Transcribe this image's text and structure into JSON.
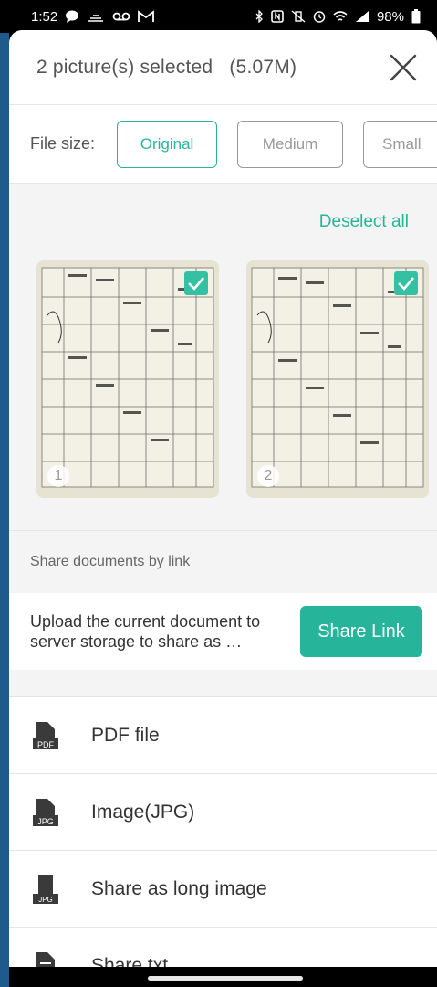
{
  "status_bar": {
    "time": "1:52",
    "battery": "98%"
  },
  "header": {
    "title": "2 picture(s) selected   (5.07M)"
  },
  "file_size": {
    "label": "File size:",
    "options": [
      "Original",
      "Medium",
      "Small"
    ],
    "selected": "Original"
  },
  "gallery": {
    "deselect_label": "Deselect all",
    "items": [
      {
        "number": "1",
        "selected": true
      },
      {
        "number": "2",
        "selected": true
      }
    ]
  },
  "share_link": {
    "heading": "Share documents by link",
    "description": "Upload the current document to server storage to share as …",
    "button_label": "Share Link"
  },
  "share_options": [
    {
      "icon": "pdf-file-icon",
      "icon_tag": "PDF",
      "label": "PDF file"
    },
    {
      "icon": "jpg-file-icon",
      "icon_tag": "JPG",
      "label": "Image(JPG)"
    },
    {
      "icon": "long-image-icon",
      "icon_tag": "JPG",
      "label": "Share as long image"
    },
    {
      "icon": "txt-file-icon",
      "icon_tag": "",
      "label": "Share txt"
    }
  ],
  "colors": {
    "accent": "#26b59a",
    "status_bar": "#000000"
  }
}
